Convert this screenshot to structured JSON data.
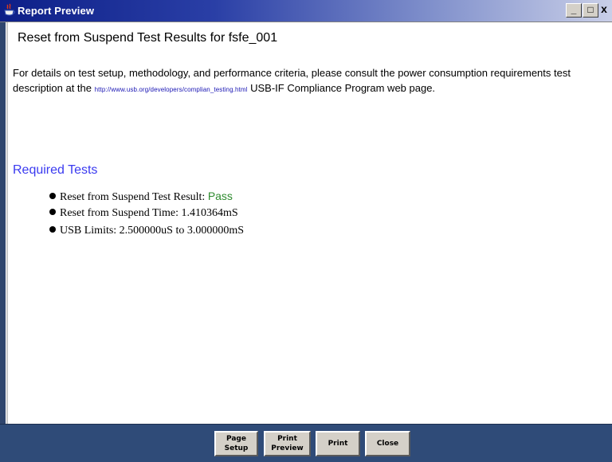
{
  "window": {
    "title": "Report Preview",
    "minimize_label": "_",
    "maximize_label": "□",
    "close_label": "x",
    "title_gradient_start": "#0d1f88",
    "panel_color": "#2f4b78"
  },
  "report": {
    "heading": "Reset from Suspend Test Results for fsfe_001",
    "details_before_link": "For details on test setup, methodology, and performance criteria, please consult the power consumption requirements test description at the ",
    "link_text": "http://www.usb.org/developers/complian_testing.html",
    "details_after_link": " USB-IF Compliance Program web page.",
    "section_title": "Required Tests",
    "section_title_color": "#3a3af0",
    "results": [
      {
        "label": "Reset from Suspend Test Result: ",
        "value": "Pass",
        "value_color": "#2e8b2e"
      },
      {
        "label": "Reset from Suspend Time: 1.410364mS"
      },
      {
        "label": "USB Limits: 2.500000uS to 3.000000mS"
      }
    ]
  },
  "buttons": {
    "page_setup_line1": "Page",
    "page_setup_line2": "Setup",
    "print_preview_line1": "Print",
    "print_preview_line2": "Preview",
    "print": "Print",
    "close": "Close"
  }
}
